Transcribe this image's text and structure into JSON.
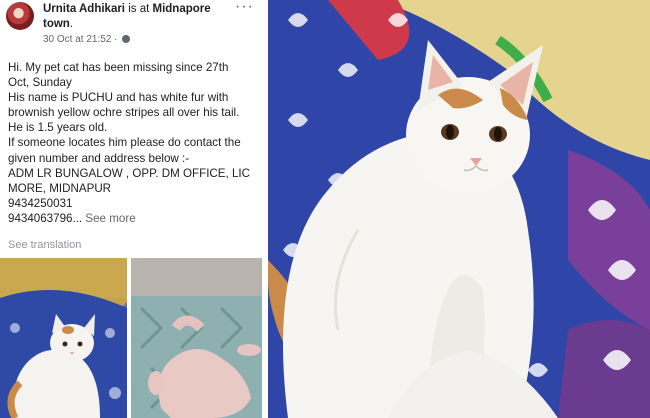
{
  "post": {
    "author": "Urnita Adhikari",
    "verb": " is at ",
    "place": "Midnapore town",
    "place_end": ".",
    "timestamp": "30 Oct at 21:52 ·",
    "more_icon": "ellipsis-icon",
    "globe_icon": "globe-icon",
    "lines": [
      "Hi. My pet cat has been missing since 27th",
      "Oct, Sunday",
      "His name is PUCHU and has white fur with",
      "brownish yellow ochre stripes all over his tail.",
      "He is 1.5 years old.",
      "If someone locates him please do contact the",
      "given number and address below :-",
      "ADM LR BUNGALOW , OPP. DM OFFICE, LIC",
      "MORE, MIDNAPUR",
      "9434250031"
    ],
    "last_line": "9434063796...",
    "see_more": " See more",
    "see_translation": "See translation"
  },
  "colors": {
    "text": "#1c1e21",
    "meta": "#606770",
    "muted": "#90949c",
    "cloth_blue": "#2f46a8",
    "cat_white": "#f6f5f2",
    "cat_orange": "#c98a4a"
  }
}
